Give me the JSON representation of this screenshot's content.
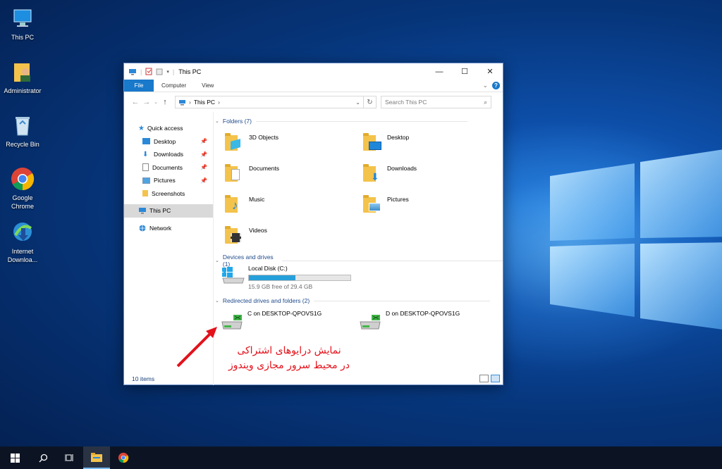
{
  "desktop": {
    "icons": [
      {
        "label": "This PC",
        "icon": "computer-icon"
      },
      {
        "label": "Administrator",
        "icon": "user-folder-icon"
      },
      {
        "label": "Recycle Bin",
        "icon": "recycle-bin-icon"
      },
      {
        "label": "Google Chrome",
        "icon": "chrome-icon"
      },
      {
        "label": "Internet Downloa...",
        "icon": "idm-icon"
      }
    ]
  },
  "window": {
    "title": "This PC",
    "ribbon": {
      "file": "File",
      "computer": "Computer",
      "view": "View"
    },
    "address": {
      "location": "This PC"
    },
    "search": {
      "placeholder": "Search This PC"
    },
    "navpane": {
      "quick_access": "Quick access",
      "items": [
        "Desktop",
        "Downloads",
        "Documents",
        "Pictures",
        "Screenshots"
      ],
      "this_pc": "This PC",
      "network": "Network"
    },
    "status": {
      "items": "10 items"
    },
    "groups": {
      "folders": "Folders (7)",
      "devices": "Devices and drives (1)",
      "redirected": "Redirected drives and folders (2)"
    },
    "folders": [
      "3D Objects",
      "Desktop",
      "Documents",
      "Downloads",
      "Music",
      "Pictures",
      "Videos"
    ],
    "drive": {
      "name": "Local Disk (C:)",
      "free": "15.9 GB free of 29.4 GB",
      "used_fraction": 0.46
    },
    "redirected": [
      "C on DESKTOP-QPOVS1G",
      "D on DESKTOP-QPOVS1G"
    ]
  },
  "annotation": {
    "line1": "نمایش درایوهای اشتراکی",
    "line2": "در محیط سرور مجازی ویندوز"
  },
  "colors": {
    "accent": "#1979ca",
    "folder": "#f4c34c",
    "annotation": "#e3121b"
  }
}
